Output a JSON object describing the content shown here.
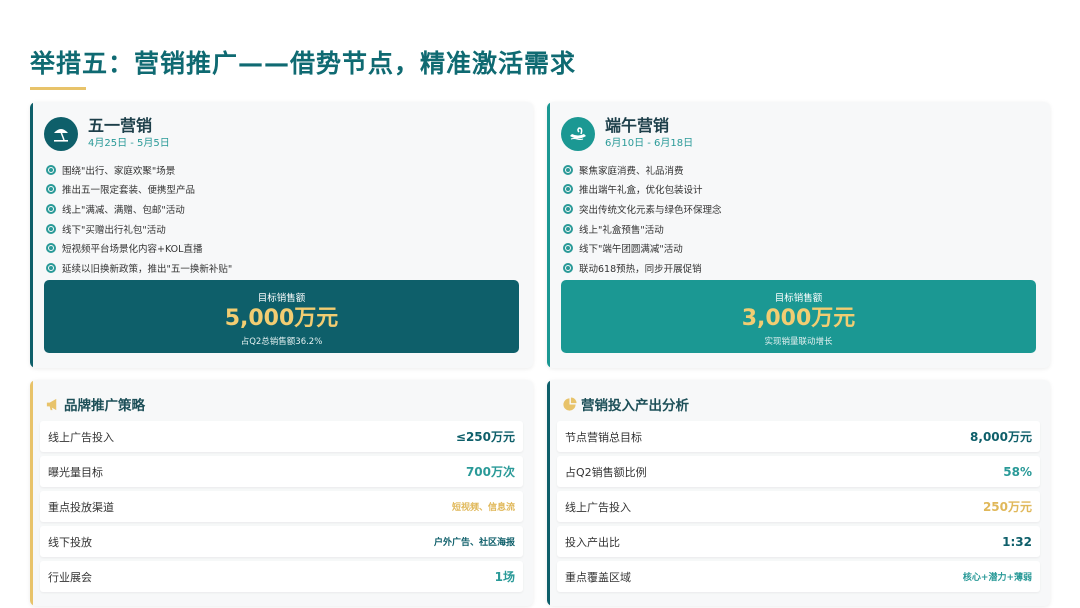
{
  "title": "举措五：营销推广——借势节点，精准激活需求",
  "colors": {
    "title": "#0f6a72",
    "dark_teal": "#0e5f6a",
    "teal": "#1b9893",
    "gold": "#e8c36a",
    "accent_teal": "#2a9a98"
  },
  "events": [
    {
      "name": "五一营销",
      "date": "4月25日 - 5月5日",
      "icon": "beach-umbrella-icon",
      "bullets": [
        "围绕\"出行、家庭欢聚\"场景",
        "推出五一限定套装、便携型产品",
        "线上\"满减、满赠、包邮\"活动",
        "线下\"买赠出行礼包\"活动",
        "短视频平台场景化内容+KOL直播",
        "延续以旧换新政策，推出\"五一换新补贴\""
      ],
      "target_label": "目标销售额",
      "target_value": "5,000万元",
      "target_sub": "占Q2总销售额36.2%"
    },
    {
      "name": "端午营销",
      "date": "6月10日 - 6月18日",
      "icon": "dragon-boat-icon",
      "bullets": [
        "聚焦家庭消费、礼品消费",
        "推出端午礼盒，优化包装设计",
        "突出传统文化元素与绿色环保理念",
        "线上\"礼盒预售\"活动",
        "线下\"端午团圆满减\"活动",
        "联动618预热，同步开展促销"
      ],
      "target_label": "目标销售额",
      "target_value": "3,000万元",
      "target_sub": "实现销量联动增长"
    }
  ],
  "brand": {
    "title": "品牌推广策略",
    "icon": "megaphone-icon",
    "rows": [
      {
        "label": "线上广告投入",
        "value": "≤250万元"
      },
      {
        "label": "曝光量目标",
        "value": "700万次"
      },
      {
        "label": "重点投放渠道",
        "value": "短视频、信息流"
      },
      {
        "label": "线下投放",
        "value": "户外广告、社区海报"
      },
      {
        "label": "行业展会",
        "value": "1场"
      }
    ]
  },
  "roi": {
    "title": "营销投入产出分析",
    "icon": "pie-chart-icon",
    "rows": [
      {
        "label": "节点营销总目标",
        "value": "8,000万元"
      },
      {
        "label": "占Q2销售额比例",
        "value": "58%"
      },
      {
        "label": "线上广告投入",
        "value": "250万元"
      },
      {
        "label": "投入产出比",
        "value": "1:32"
      },
      {
        "label": "重点覆盖区域",
        "value": "核心+潜力+薄弱"
      }
    ]
  }
}
